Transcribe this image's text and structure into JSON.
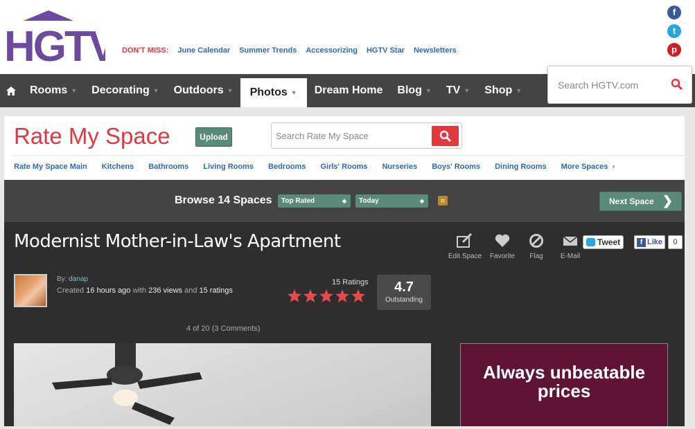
{
  "brand": {
    "logo_text": "HGTV",
    "color": "#6c4a9e"
  },
  "dont_miss": {
    "label": "DON'T MISS:",
    "links": [
      "June Calendar",
      "Summer Trends",
      "Accessorizing",
      "HGTV Star",
      "Newsletters"
    ]
  },
  "social": [
    "facebook-icon",
    "twitter-icon",
    "pinterest-icon"
  ],
  "nav": {
    "items": [
      {
        "label": "Rooms"
      },
      {
        "label": "Decorating"
      },
      {
        "label": "Outdoors"
      },
      {
        "label": "Photos"
      },
      {
        "label": "Dream Home"
      },
      {
        "label": "Blog"
      },
      {
        "label": "TV"
      },
      {
        "label": "Shop"
      }
    ],
    "active": "Photos"
  },
  "site_search": {
    "placeholder": "Search HGTV.com"
  },
  "rms": {
    "title": "Rate My Space",
    "upload_label": "Upload",
    "search_placeholder": "Search Rate My Space",
    "subnav": [
      "Rate My Space Main",
      "Kitchens",
      "Bathrooms",
      "Living Rooms",
      "Bedrooms",
      "Girls' Rooms",
      "Nurseries",
      "Boys' Rooms",
      "Dining Rooms",
      "More Spaces"
    ]
  },
  "browse": {
    "label": "Browse 14 Spaces",
    "sort_value": "Top Rated",
    "period_value": "Today",
    "next_label": "Next Space"
  },
  "space": {
    "title": "Modernist Mother-in-Law's Apartment",
    "actions": [
      "Edit Space",
      "Favorite",
      "Flag",
      "E-Mail"
    ],
    "tweet_label": "Tweet",
    "like_label": "Like",
    "like_count": "0",
    "by_label": "By:",
    "author": "danap",
    "created_prefix": "Created",
    "created_time": "16 hours ago",
    "views_prefix": "with",
    "views": "236 views",
    "ratings_prefix": "and",
    "ratings": "15 ratings",
    "ratings_count_label": "15 Ratings",
    "stars": 5,
    "score": "4.7",
    "score_label": "Outstanding",
    "pager": "4 of 20 (3 Comments)"
  },
  "ad": {
    "text": "Always unbeatable prices"
  },
  "colors": {
    "accent_red": "#e0383e",
    "teal": "#5a8a78",
    "link_blue": "#2c6bb1"
  }
}
